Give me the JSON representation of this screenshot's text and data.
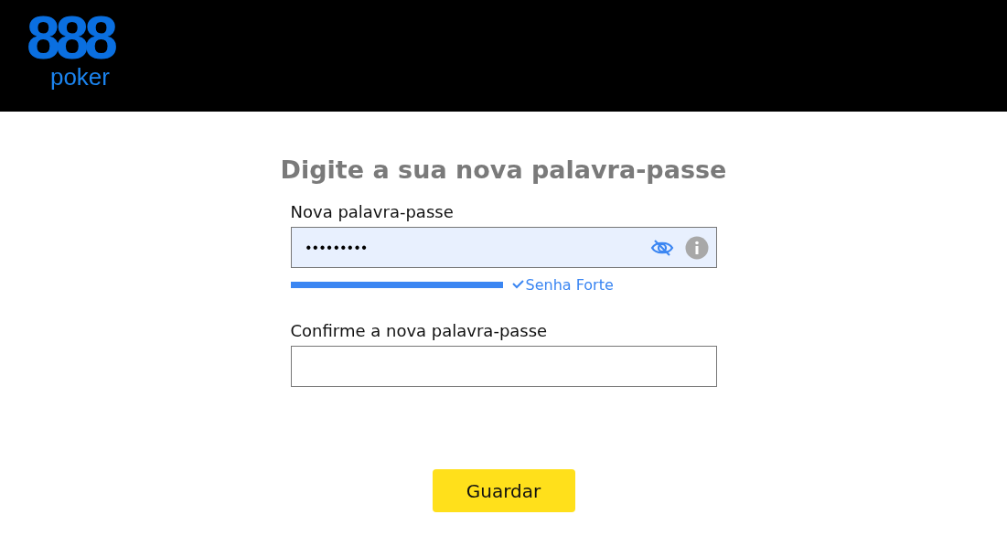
{
  "header": {
    "logo": {
      "number": "888",
      "word": "poker"
    }
  },
  "title": "Digite a sua nova palavra-passe",
  "fields": [
    {
      "label": "Nova palavra-passe",
      "value": "•••••••••",
      "focused": true,
      "strength": {
        "text": "Senha Forte"
      }
    },
    {
      "label": "Confirme a nova palavra-passe",
      "focused": false
    }
  ],
  "button": "Guardar"
}
